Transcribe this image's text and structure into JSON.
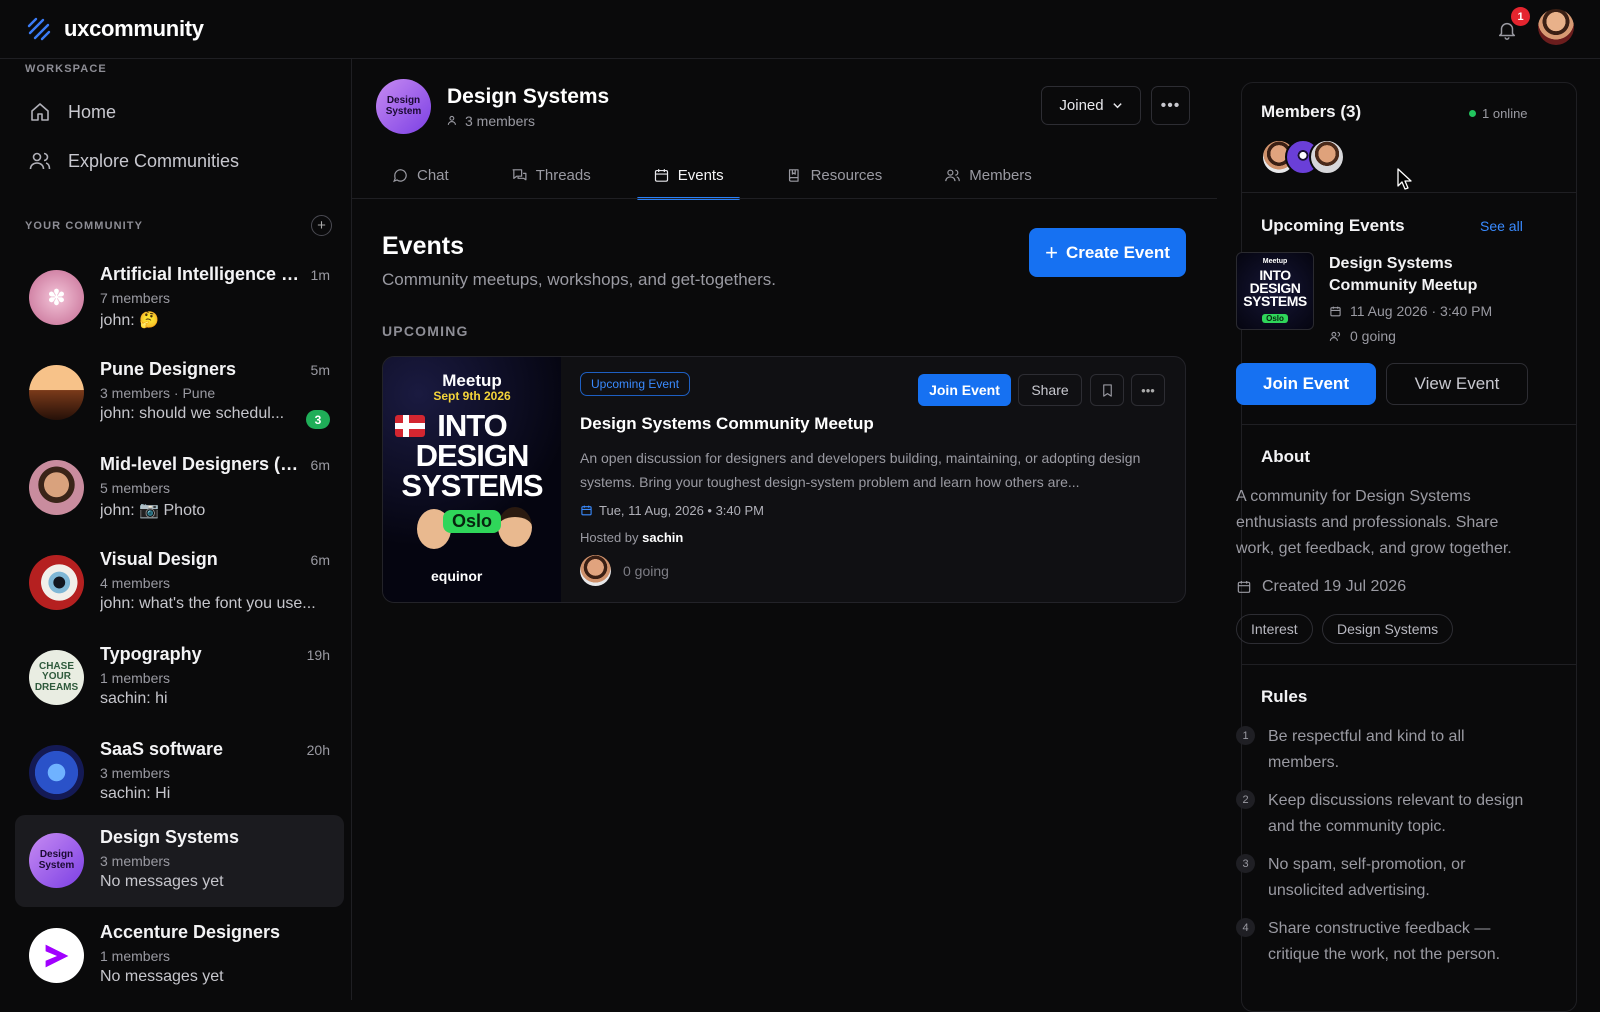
{
  "app": {
    "name": "uxcommunity",
    "notification_count": "1"
  },
  "sidebar": {
    "workspace_label": "WORKSPACE",
    "nav": [
      {
        "label": "Home",
        "icon": "home-icon"
      },
      {
        "label": "Explore Communities",
        "icon": "users-icon"
      }
    ],
    "your_community_label": "YOUR COMMUNITY",
    "communities": [
      {
        "name": "Artificial Intelligence & ...",
        "time": "1m",
        "meta": "7 members",
        "last": "john: 🤔",
        "unread": ""
      },
      {
        "name": "Pune Designers",
        "time": "5m",
        "meta": "3 members · Pune",
        "last": "john: should we schedul...",
        "unread": "3"
      },
      {
        "name": "Mid-level Designers (3-...",
        "time": "6m",
        "meta": "5 members",
        "last": "john: 📷 Photo",
        "unread": ""
      },
      {
        "name": "Visual Design",
        "time": "6m",
        "meta": "4 members",
        "last": "john: what's the font you use...",
        "unread": ""
      },
      {
        "name": "Typography",
        "time": "19h",
        "meta": "1 members",
        "last": "sachin: hi",
        "unread": ""
      },
      {
        "name": "SaaS software",
        "time": "20h",
        "meta": "3 members",
        "last": "sachin: Hi",
        "unread": ""
      },
      {
        "name": "Design Systems",
        "time": "",
        "meta": "3 members",
        "last": "No messages yet",
        "unread": ""
      },
      {
        "name": "Accenture Designers",
        "time": "",
        "meta": "1 members",
        "last": "No messages yet",
        "unread": ""
      }
    ],
    "avatar_texts": {
      "typography": "CHASE YOUR DREAMS",
      "design_systems": "Design System"
    }
  },
  "group": {
    "name": "Design Systems",
    "members": "3 members",
    "avatar_text": "Design System",
    "joined_label": "Joined"
  },
  "tabs": [
    "Chat",
    "Threads",
    "Events",
    "Resources",
    "Members"
  ],
  "events": {
    "title": "Events",
    "subtitle": "Community meetups, workshops, and get-togethers.",
    "create_label": "Create Event",
    "upcoming_label": "UPCOMING",
    "card": {
      "badge": "Upcoming Event",
      "join_label": "Join Event",
      "share_label": "Share",
      "title": "Design Systems Community Meetup",
      "description": "An open discussion for designers and developers building, maintaining, or adopting design systems. Bring your toughest design-system problem and learn how others are...",
      "date": "Tue, 11 Aug, 2026 • 3:40 PM",
      "hosted_by_prefix": "Hosted by",
      "host": "sachin",
      "going": "0 going",
      "poster": {
        "line1": "Meetup",
        "line2": "Sept 9th 2026",
        "line3": "INTO DESIGN SYSTEMS",
        "city": "Oslo",
        "brand": "equinor"
      }
    }
  },
  "right_panel": {
    "members_title": "Members (3)",
    "online": "1 online",
    "upcoming_title": "Upcoming Events",
    "see_all": "See all",
    "event_title": "Design Systems Community Meetup",
    "event_date": "11 Aug 2026 · 3:40 PM",
    "event_going": "0 going",
    "join_label": "Join Event",
    "view_label": "View Event",
    "thumb": {
      "line1": "Meetup",
      "line2": "INTO DESIGN SYSTEMS",
      "city": "Oslo"
    },
    "about_title": "About",
    "about_text": "A community for Design Systems enthusiasts and professionals. Share work, get feedback, and grow together.",
    "created": "Created 19 Jul 2026",
    "tags": [
      "Interest",
      "Design Systems"
    ],
    "rules_title": "Rules",
    "rules": [
      {
        "n": "1",
        "text": "Be respectful and kind to all members."
      },
      {
        "n": "2",
        "text": "Keep discussions relevant to design and the community topic."
      },
      {
        "n": "3",
        "text": "No spam, self-promotion, or unsolicited advertising."
      },
      {
        "n": "4",
        "text": "Share constructive feedback — critique the work, not the person."
      }
    ]
  },
  "colors": {
    "accent": "#1671f2",
    "background": "#0a0a0b",
    "online": "#22c55e",
    "unread": "#1fae58",
    "notification": "#e5252f"
  }
}
